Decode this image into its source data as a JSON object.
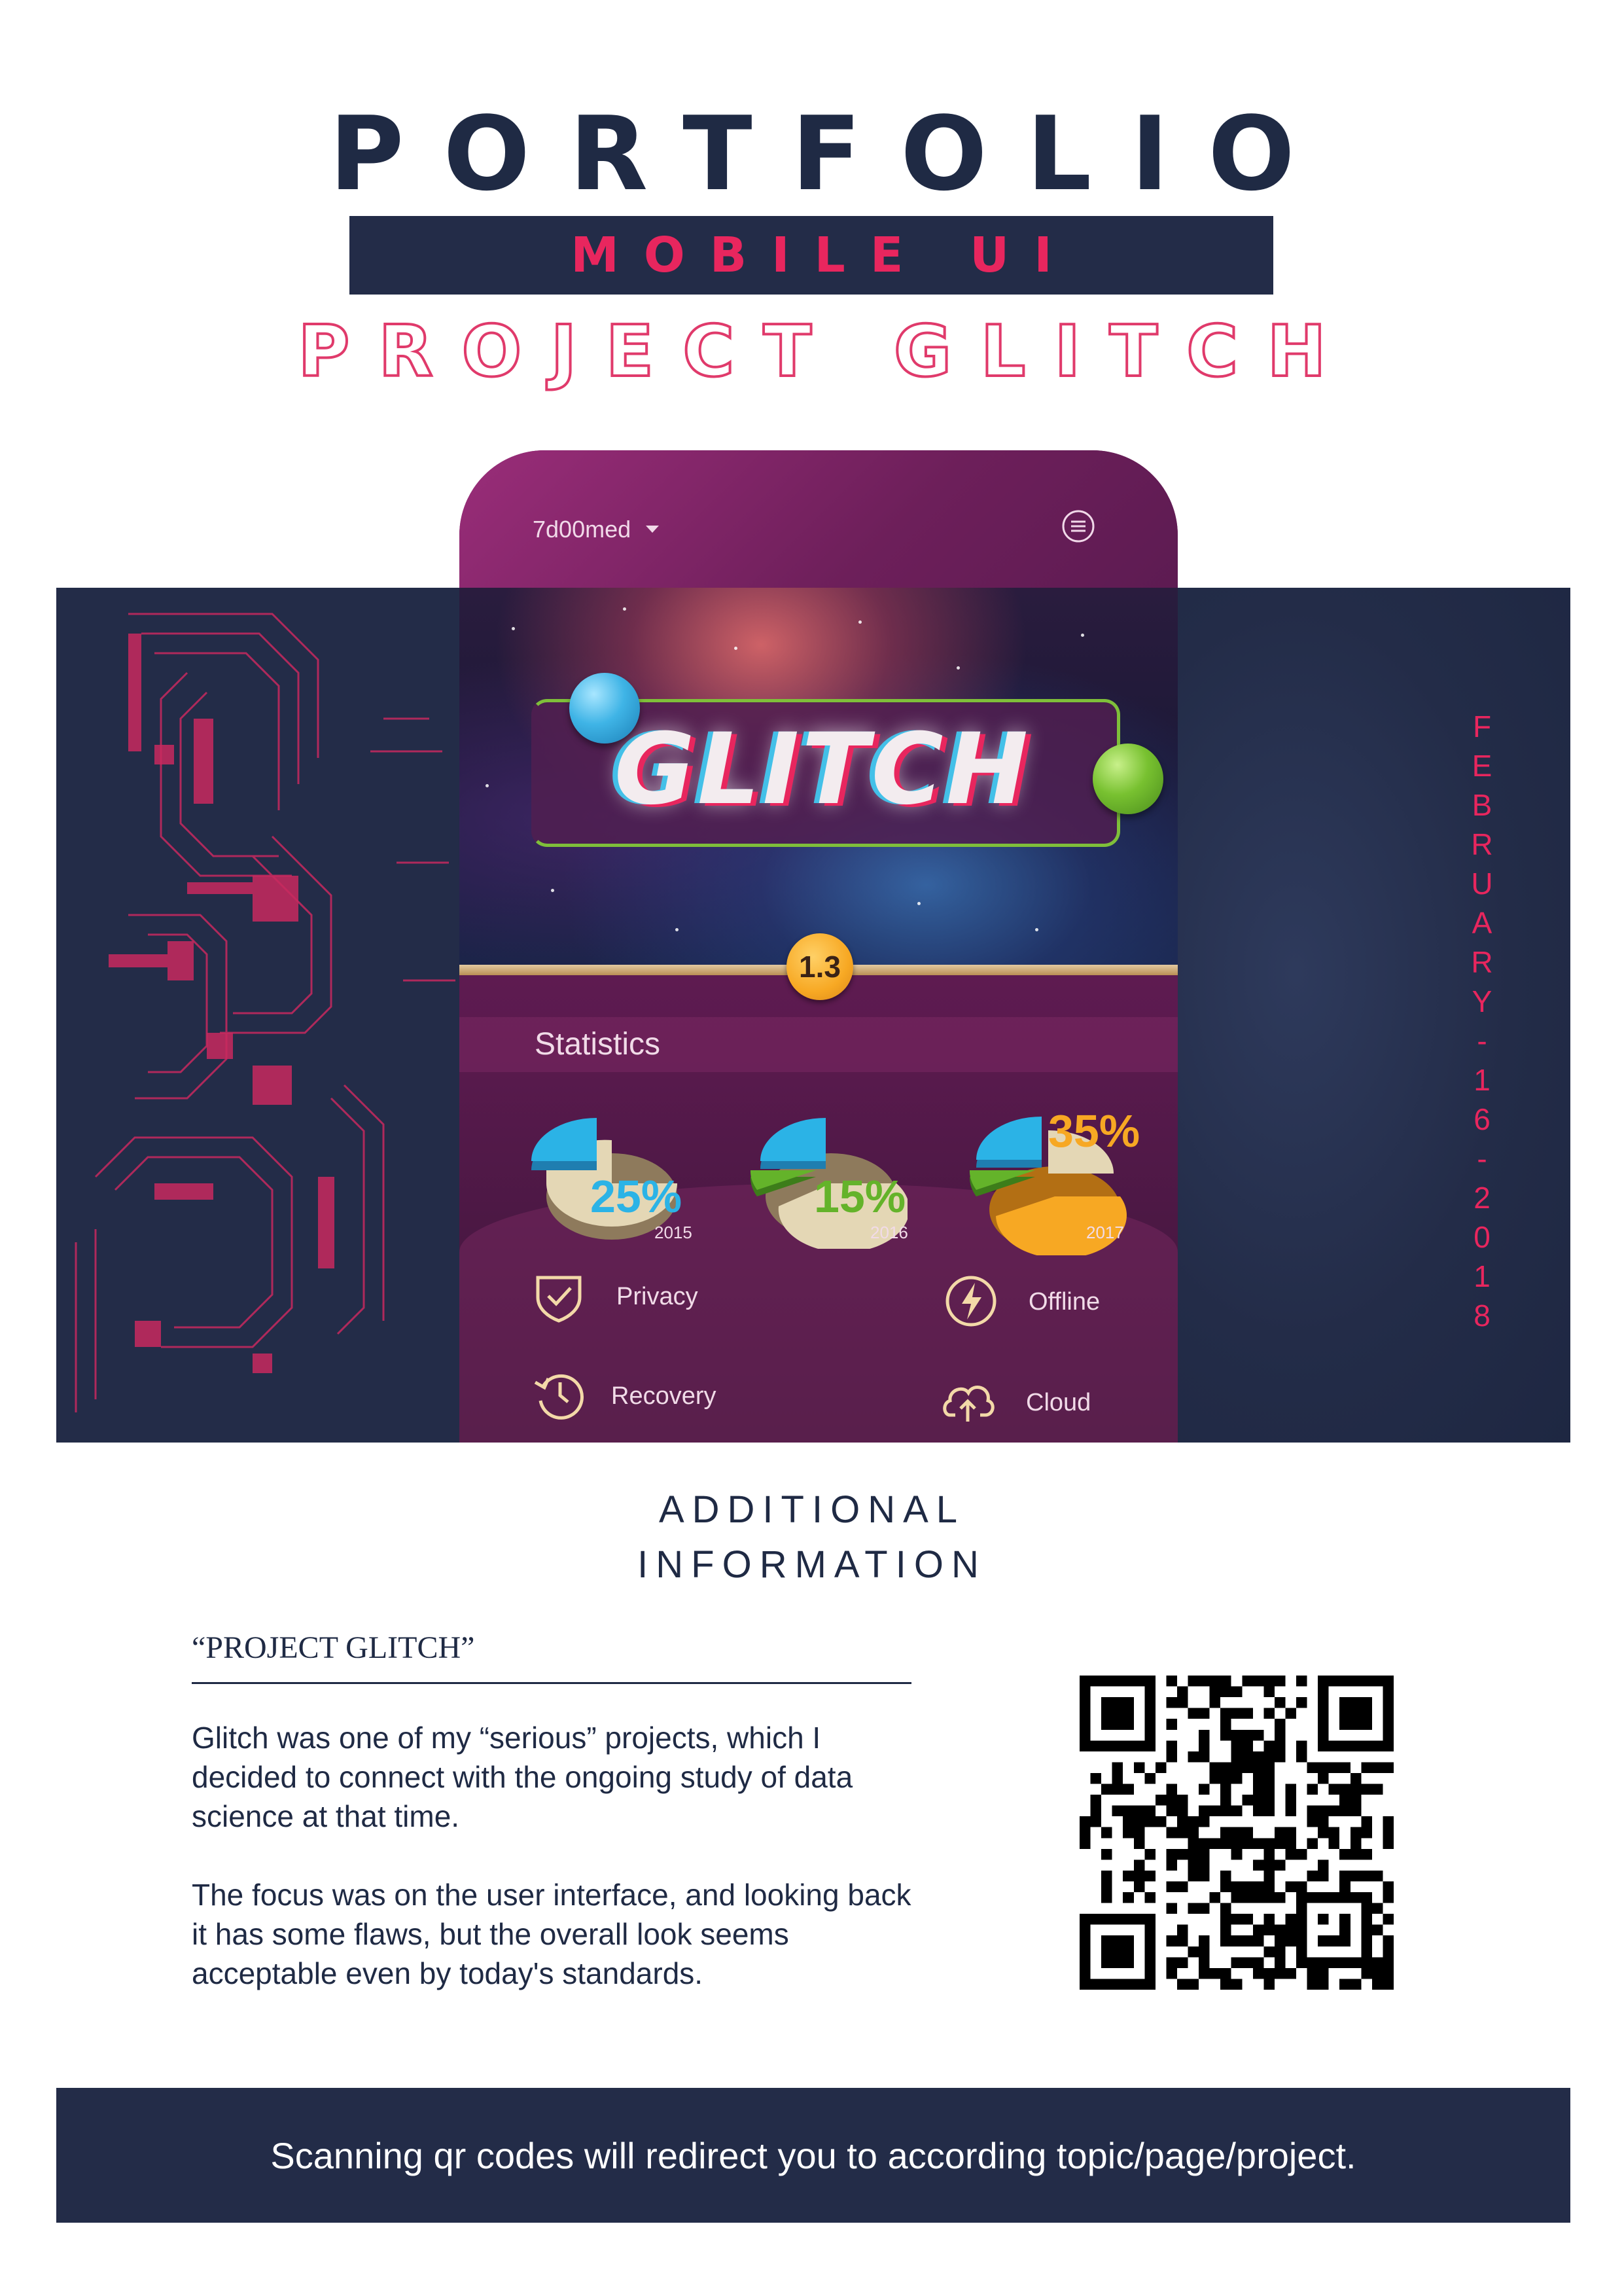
{
  "header": {
    "title": "PORTFOLIO",
    "subtitle": "MOBILE UI",
    "project": "PROJECT GLITCH"
  },
  "date_vertical": [
    "F",
    "E",
    "B",
    "R",
    "U",
    "A",
    "R",
    "Y",
    "-",
    "1",
    "6",
    "-",
    "2",
    "0",
    "1",
    "8"
  ],
  "phone": {
    "username": "7d00med",
    "hero_word": "GLITCH",
    "version": "1.3",
    "statistics_title": "Statistics",
    "stats": [
      {
        "percent": "25%",
        "year": "2015",
        "color": "#2bb3e6"
      },
      {
        "percent": "15%",
        "year": "2016",
        "color": "#64b32a"
      },
      {
        "percent": "35%",
        "year": "2017",
        "color": "#f7a823"
      }
    ],
    "features": {
      "privacy": "Privacy",
      "offline": "Offline",
      "recovery": "Recovery",
      "cloud": "Cloud"
    }
  },
  "additional": {
    "heading_line1": "ADDITIONAL",
    "heading_line2": "INFORMATION",
    "project_heading": "“PROJECT GLITCH”",
    "paragraph1": "Glitch was one of my “serious” projects, which I decided to connect with the ongoing study of data science at that time.",
    "paragraph2": "The focus was on the user interface, and looking back it has some flaws, but the overall look seems acceptable even by today's standards."
  },
  "footer": {
    "text": "Scanning qr codes will redirect you to according topic/page/project."
  },
  "colors": {
    "navy": "#232c48",
    "accent_pink": "#e8265e",
    "blue": "#2bb3e6",
    "green": "#64b32a",
    "orange": "#f7a823"
  }
}
